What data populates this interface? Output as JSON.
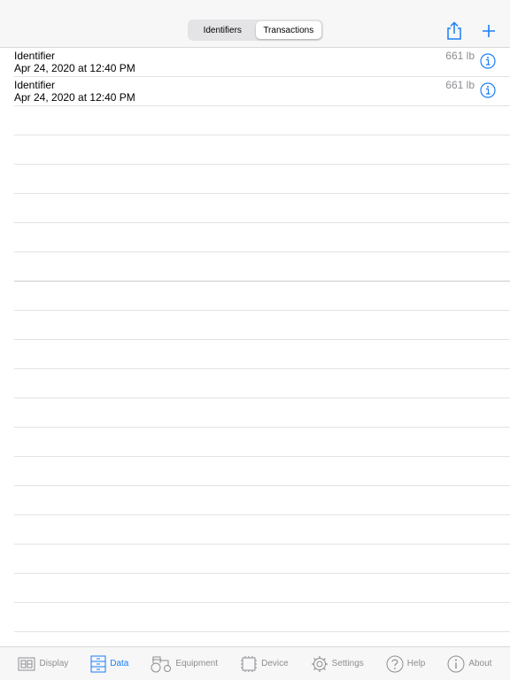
{
  "colors": {
    "accent": "#1a7ef5",
    "inactive": "#8e8e93"
  },
  "segments": [
    {
      "label": "Identifiers",
      "active": false
    },
    {
      "label": "Transactions",
      "active": true
    }
  ],
  "nav": {
    "share_icon": "share-icon",
    "add_icon": "plus-icon"
  },
  "transactions": [
    {
      "title": "Identifier",
      "date": "Apr 24, 2020 at 12:40 PM",
      "weight": "661 lb"
    },
    {
      "title": "Identifier",
      "date": "Apr 24, 2020 at 12:40 PM",
      "weight": "661 lb"
    }
  ],
  "tabs": [
    {
      "label": "Display",
      "icon": "display-icon",
      "active": false
    },
    {
      "label": "Data",
      "icon": "cabinet-icon",
      "active": true
    },
    {
      "label": "Equipment",
      "icon": "tractor-icon",
      "active": false
    },
    {
      "label": "Device",
      "icon": "chip-icon",
      "active": false
    },
    {
      "label": "Settings",
      "icon": "gear-icon",
      "active": false
    },
    {
      "label": "Help",
      "icon": "question-icon",
      "active": false
    },
    {
      "label": "About",
      "icon": "info-icon",
      "active": false
    }
  ]
}
